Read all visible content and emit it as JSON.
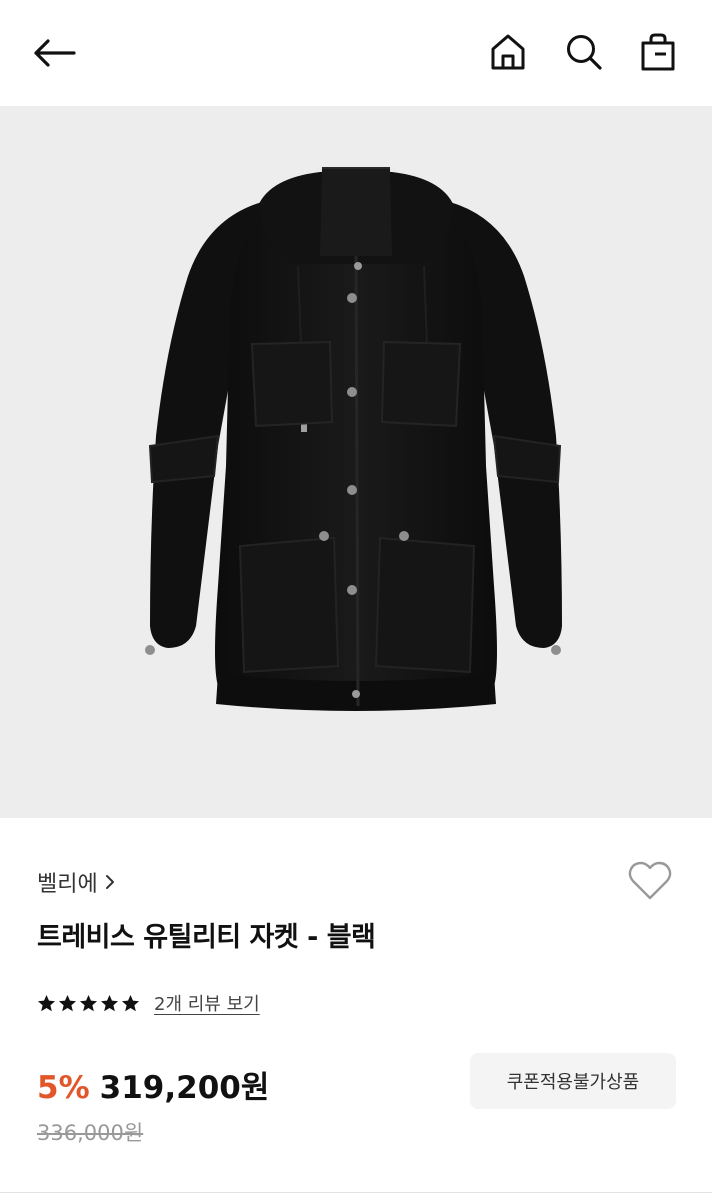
{
  "header": {
    "icons": [
      "arrow-left-icon",
      "home-icon",
      "search-icon",
      "shopping-bag-icon"
    ]
  },
  "product": {
    "brand": "벨리에",
    "name": "트레비스 유틸리티 자켓 - 블랙",
    "rating": 5,
    "review_link": "2개 리뷰 보기",
    "discount": "5%",
    "price": "319,200원",
    "original_price": "336,000원",
    "coupon_label": "쿠폰적용불가상품"
  },
  "colors": {
    "discount": "#e2572a",
    "image_background": "#ededed",
    "jacket": "#141414"
  }
}
